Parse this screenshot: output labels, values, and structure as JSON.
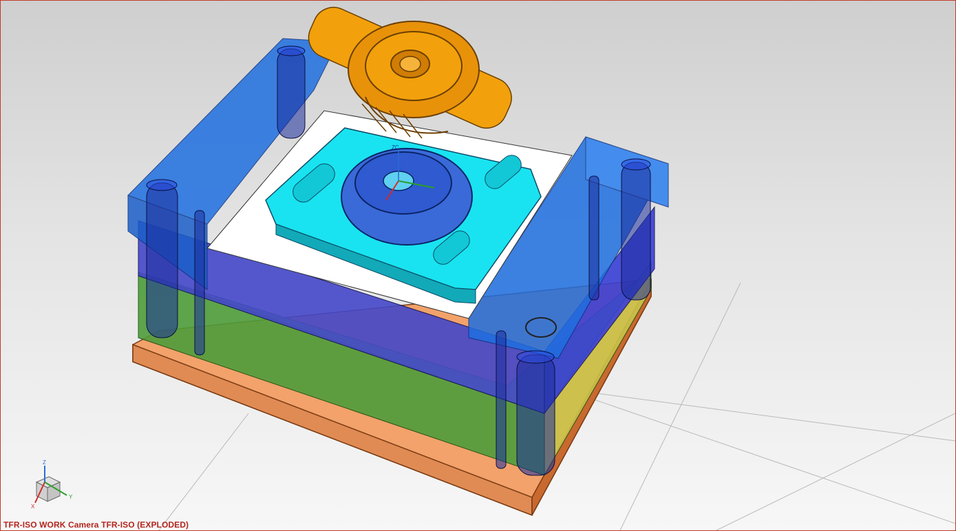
{
  "viewport": {
    "status_text": "TFR-ISO WORK Camera TFR-ISO (EXPLODED)",
    "border_color": "#c0392b",
    "status_color": "#b3261e"
  },
  "model": {
    "assembly": "mold-base-exploded",
    "components": [
      {
        "name": "cast-part",
        "color": "#f2a10c"
      },
      {
        "name": "core-insert",
        "color": "#19e3f0"
      },
      {
        "name": "top-clamp-plate",
        "color": "#1f6fe0"
      },
      {
        "name": "cavity-plate",
        "color": "#3a3fd6"
      },
      {
        "name": "support-plate",
        "color": "#5fb34a"
      },
      {
        "name": "bottom-clamp-plate",
        "color": "#f2a26a"
      },
      {
        "name": "guide-pillars",
        "color": "#1b2e9c"
      }
    ],
    "wcs_label": "ZC"
  },
  "triad": {
    "z_label": "Z",
    "x_label": "X",
    "y_label": "Y",
    "z_color": "#2d6bd6",
    "x_color": "#d22c2c",
    "y_color": "#2aa02a"
  }
}
